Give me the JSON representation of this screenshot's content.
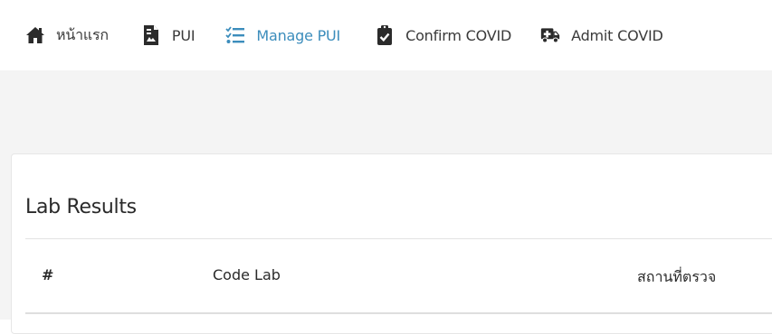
{
  "nav": {
    "items": [
      {
        "label": "หน้าแรก",
        "icon": "home-icon",
        "active": false
      },
      {
        "label": "PUI",
        "icon": "document-icon",
        "active": false
      },
      {
        "label": "Manage PUI",
        "icon": "checklist-icon",
        "active": true
      },
      {
        "label": "Confirm COVID",
        "icon": "clipboard-check-icon",
        "active": false
      },
      {
        "label": "Admit COVID",
        "icon": "ambulance-icon",
        "active": false
      }
    ],
    "active_color": "#3c8dbc",
    "text_color": "#3a3a3a"
  },
  "card": {
    "title": "Lab Results",
    "table": {
      "columns": [
        "#",
        "Code Lab",
        "สถานที่ตรวจ"
      ]
    }
  }
}
